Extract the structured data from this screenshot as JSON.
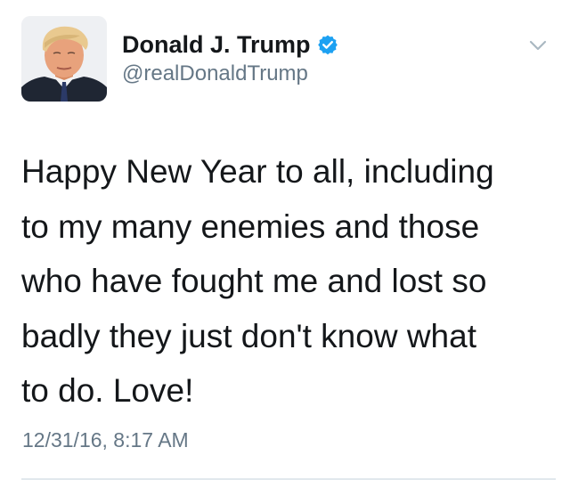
{
  "tweet": {
    "author": {
      "display_name": "Donald J. Trump",
      "handle": "@realDonaldTrump",
      "verified": true
    },
    "text_lines": [
      "Happy New Year to all, including",
      "to my many enemies and those",
      "who have fought me and lost so",
      "badly they just don't know what",
      "to do. Love!"
    ],
    "timestamp": "12/31/16, 8:17 AM"
  },
  "icons": {
    "verified": "verified-badge-icon",
    "menu": "chevron-down-icon"
  },
  "colors": {
    "text_primary": "#14171a",
    "text_secondary": "#657786",
    "verified_blue": "#1da1f2",
    "chevron": "#aab8c2",
    "divider": "#e1e8ed"
  }
}
